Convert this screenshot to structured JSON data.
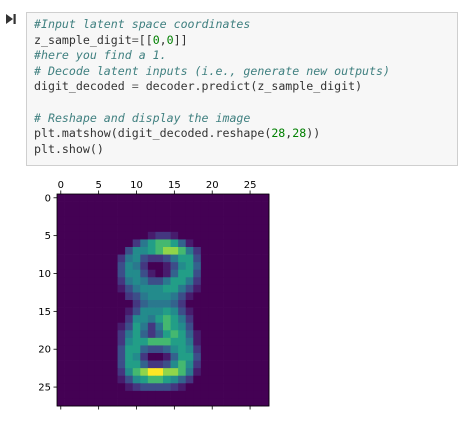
{
  "cell": {
    "run_icon": "step-forward-icon",
    "lines": [
      [
        {
          "t": "#Input latent space coordinates",
          "c": "comment"
        }
      ],
      [
        {
          "t": "z_sample_digit",
          "c": "code"
        },
        {
          "t": "=",
          "c": "op"
        },
        {
          "t": "[[",
          "c": "code"
        },
        {
          "t": "0",
          "c": "num"
        },
        {
          "t": ",",
          "c": "code"
        },
        {
          "t": "0",
          "c": "num"
        },
        {
          "t": "]]",
          "c": "code"
        }
      ],
      [
        {
          "t": "#here you find a 1.",
          "c": "comment"
        }
      ],
      [
        {
          "t": "# Decode latent inputs (i.e., generate new outputs)",
          "c": "comment"
        }
      ],
      [
        {
          "t": "digit_decoded ",
          "c": "code"
        },
        {
          "t": "=",
          "c": "op"
        },
        {
          "t": " decoder.predict(z_sample_digit)",
          "c": "code"
        }
      ],
      [
        {
          "t": "",
          "c": "code"
        }
      ],
      [
        {
          "t": "# Reshape and display the image",
          "c": "comment"
        }
      ],
      [
        {
          "t": "plt.matshow(digit_decoded.reshape(",
          "c": "code"
        },
        {
          "t": "28",
          "c": "num"
        },
        {
          "t": ",",
          "c": "code"
        },
        {
          "t": "28",
          "c": "num"
        },
        {
          "t": "))",
          "c": "code"
        }
      ],
      [
        {
          "t": "plt.show()",
          "c": "code"
        }
      ]
    ]
  },
  "colors": {
    "comment": "#408080",
    "code": "#333333",
    "op": "#666666",
    "num": "#008000",
    "viridis_low": "#440154",
    "viridis_high": "#fde725"
  },
  "chart_data": {
    "type": "heatmap",
    "colormap": "viridis",
    "shape": [
      28,
      28
    ],
    "xlim": [
      -0.5,
      27.5
    ],
    "ylim": [
      27.5,
      -0.5
    ],
    "x_ticks": [
      0,
      5,
      10,
      15,
      20,
      25
    ],
    "y_ticks": [
      0,
      5,
      10,
      15,
      20,
      25
    ],
    "x_tick_labels": [
      "0",
      "5",
      "10",
      "15",
      "20",
      "25"
    ],
    "y_tick_labels": [
      "0",
      "5",
      "10",
      "15",
      "20",
      "25"
    ],
    "x_axis_position": "top",
    "value_range": [
      0,
      1
    ],
    "title": "",
    "xlabel": "",
    "ylabel": "",
    "depicted_shape": "figure eight (digit 8): upper loop rows 6-13, lower loop rows 16-25, waist near row 14",
    "rows": [
      [
        0,
        0,
        0,
        0,
        0,
        0,
        0,
        0,
        0,
        0,
        0,
        0,
        0,
        0,
        0,
        0,
        0,
        0,
        0,
        0,
        0,
        0,
        0,
        0,
        0,
        0,
        0,
        0
      ],
      [
        0,
        0,
        0,
        0,
        0,
        0,
        0,
        0,
        0,
        0,
        0,
        0,
        0,
        0,
        0,
        0,
        0,
        0,
        0,
        0,
        0,
        0,
        0,
        0,
        0,
        0,
        0,
        0
      ],
      [
        0,
        0,
        0,
        0,
        0,
        0,
        0,
        0,
        0,
        0,
        0,
        0,
        0,
        0,
        0,
        0,
        0,
        0,
        0,
        0,
        0,
        0,
        0,
        0,
        0,
        0,
        0,
        0
      ],
      [
        0,
        0,
        0,
        0,
        0,
        0,
        0,
        0,
        0,
        0,
        0,
        0,
        0,
        0,
        0,
        0,
        0,
        0,
        0,
        0,
        0,
        0,
        0,
        0,
        0,
        0,
        0,
        0
      ],
      [
        0,
        0,
        0,
        0,
        0,
        0,
        0,
        0,
        0,
        0,
        0,
        0,
        0,
        0,
        0,
        0,
        0,
        0,
        0,
        0,
        0,
        0,
        0,
        0,
        0,
        0,
        0,
        0
      ],
      [
        0,
        0,
        0,
        0,
        0,
        0,
        0,
        0,
        0,
        0,
        0,
        0,
        0.1,
        0.2,
        0.2,
        0.1,
        0,
        0,
        0,
        0,
        0,
        0,
        0,
        0,
        0,
        0,
        0,
        0
      ],
      [
        0,
        0,
        0,
        0,
        0,
        0,
        0,
        0,
        0,
        0,
        0.2,
        0.5,
        0.7,
        0.8,
        0.8,
        0.7,
        0.4,
        0.1,
        0,
        0,
        0,
        0,
        0,
        0,
        0,
        0,
        0,
        0
      ],
      [
        0,
        0,
        0,
        0,
        0,
        0,
        0,
        0,
        0,
        0.3,
        0.6,
        0.6,
        0.7,
        0.8,
        0.9,
        0.9,
        0.8,
        0.5,
        0.2,
        0,
        0,
        0,
        0,
        0,
        0,
        0,
        0,
        0
      ],
      [
        0,
        0,
        0,
        0,
        0,
        0,
        0,
        0,
        0.2,
        0.5,
        0.6,
        0.3,
        0.2,
        0.2,
        0.3,
        0.5,
        0.7,
        0.7,
        0.3,
        0,
        0,
        0,
        0,
        0,
        0,
        0,
        0,
        0
      ],
      [
        0,
        0,
        0,
        0,
        0,
        0,
        0,
        0,
        0.3,
        0.6,
        0.5,
        0.2,
        0,
        0,
        0.1,
        0.3,
        0.6,
        0.7,
        0.4,
        0,
        0,
        0,
        0,
        0,
        0,
        0,
        0,
        0
      ],
      [
        0,
        0,
        0,
        0,
        0,
        0,
        0,
        0,
        0.3,
        0.6,
        0.6,
        0.3,
        0.1,
        0,
        0.1,
        0.4,
        0.7,
        0.7,
        0.3,
        0,
        0,
        0,
        0,
        0,
        0,
        0,
        0,
        0
      ],
      [
        0,
        0,
        0,
        0,
        0,
        0,
        0,
        0,
        0.2,
        0.5,
        0.6,
        0.5,
        0.3,
        0.3,
        0.5,
        0.7,
        0.7,
        0.5,
        0.2,
        0,
        0,
        0,
        0,
        0,
        0,
        0,
        0,
        0
      ],
      [
        0,
        0,
        0,
        0,
        0,
        0,
        0,
        0,
        0.1,
        0.3,
        0.5,
        0.6,
        0.6,
        0.6,
        0.7,
        0.7,
        0.5,
        0.3,
        0.1,
        0,
        0,
        0,
        0,
        0,
        0,
        0,
        0,
        0
      ],
      [
        0,
        0,
        0,
        0,
        0,
        0,
        0,
        0,
        0,
        0.2,
        0.3,
        0.5,
        0.6,
        0.6,
        0.6,
        0.5,
        0.3,
        0.1,
        0,
        0,
        0,
        0,
        0,
        0,
        0,
        0,
        0,
        0
      ],
      [
        0,
        0,
        0,
        0,
        0,
        0,
        0,
        0,
        0,
        0,
        0.2,
        0.4,
        0.5,
        0.5,
        0.5,
        0.4,
        0.2,
        0,
        0,
        0,
        0,
        0,
        0,
        0,
        0,
        0,
        0,
        0
      ],
      [
        0,
        0,
        0,
        0,
        0,
        0,
        0,
        0,
        0,
        0.1,
        0.3,
        0.6,
        0.6,
        0.6,
        0.7,
        0.6,
        0.3,
        0.1,
        0,
        0,
        0,
        0,
        0,
        0,
        0,
        0,
        0,
        0
      ],
      [
        0,
        0,
        0,
        0,
        0,
        0,
        0,
        0,
        0,
        0.2,
        0.6,
        0.6,
        0.5,
        0.7,
        0.8,
        0.7,
        0.5,
        0.2,
        0,
        0,
        0,
        0,
        0,
        0,
        0,
        0,
        0,
        0
      ],
      [
        0,
        0,
        0,
        0,
        0,
        0,
        0,
        0,
        0.1,
        0.3,
        0.7,
        0.5,
        0.2,
        0.5,
        0.8,
        0.7,
        0.6,
        0.3,
        0,
        0,
        0,
        0,
        0,
        0,
        0,
        0,
        0,
        0
      ],
      [
        0,
        0,
        0,
        0,
        0,
        0,
        0,
        0,
        0.2,
        0.5,
        0.7,
        0.4,
        0.2,
        0.4,
        0.7,
        0.8,
        0.7,
        0.4,
        0.1,
        0,
        0,
        0,
        0,
        0,
        0,
        0,
        0,
        0
      ],
      [
        0,
        0,
        0,
        0,
        0,
        0,
        0,
        0,
        0.2,
        0.6,
        0.7,
        0.7,
        0.8,
        0.8,
        0.8,
        0.7,
        0.7,
        0.5,
        0.1,
        0,
        0,
        0,
        0,
        0,
        0,
        0,
        0,
        0
      ],
      [
        0,
        0,
        0,
        0,
        0,
        0,
        0,
        0,
        0.3,
        0.7,
        0.7,
        0.4,
        0.3,
        0.3,
        0.4,
        0.6,
        0.7,
        0.6,
        0.2,
        0,
        0,
        0,
        0,
        0,
        0,
        0,
        0,
        0
      ],
      [
        0,
        0,
        0,
        0,
        0,
        0,
        0,
        0,
        0.3,
        0.7,
        0.6,
        0.2,
        0,
        0,
        0.1,
        0.4,
        0.7,
        0.7,
        0.3,
        0,
        0,
        0,
        0,
        0,
        0,
        0,
        0,
        0
      ],
      [
        0,
        0,
        0,
        0,
        0,
        0,
        0,
        0,
        0.3,
        0.7,
        0.7,
        0.4,
        0.2,
        0.2,
        0.3,
        0.6,
        0.8,
        0.6,
        0.2,
        0,
        0,
        0,
        0,
        0,
        0,
        0,
        0,
        0
      ],
      [
        0,
        0,
        0,
        0,
        0,
        0,
        0,
        0,
        0.2,
        0.6,
        0.8,
        0.9,
        1.0,
        1.0,
        0.9,
        0.9,
        0.8,
        0.5,
        0.1,
        0,
        0,
        0,
        0,
        0,
        0,
        0,
        0,
        0
      ],
      [
        0,
        0,
        0,
        0,
        0,
        0,
        0,
        0,
        0.1,
        0.3,
        0.6,
        0.7,
        0.8,
        0.8,
        0.7,
        0.6,
        0.4,
        0.2,
        0,
        0,
        0,
        0,
        0,
        0,
        0,
        0,
        0,
        0
      ],
      [
        0,
        0,
        0,
        0,
        0,
        0,
        0,
        0,
        0,
        0.1,
        0.2,
        0.3,
        0.3,
        0.3,
        0.3,
        0.2,
        0.1,
        0,
        0,
        0,
        0,
        0,
        0,
        0,
        0,
        0,
        0,
        0
      ],
      [
        0,
        0,
        0,
        0,
        0,
        0,
        0,
        0,
        0,
        0,
        0,
        0,
        0,
        0,
        0,
        0,
        0,
        0,
        0,
        0,
        0,
        0,
        0,
        0,
        0,
        0,
        0,
        0
      ],
      [
        0,
        0,
        0,
        0,
        0,
        0,
        0,
        0,
        0,
        0,
        0,
        0,
        0,
        0,
        0,
        0,
        0,
        0,
        0,
        0,
        0,
        0,
        0,
        0,
        0,
        0,
        0,
        0
      ]
    ]
  }
}
